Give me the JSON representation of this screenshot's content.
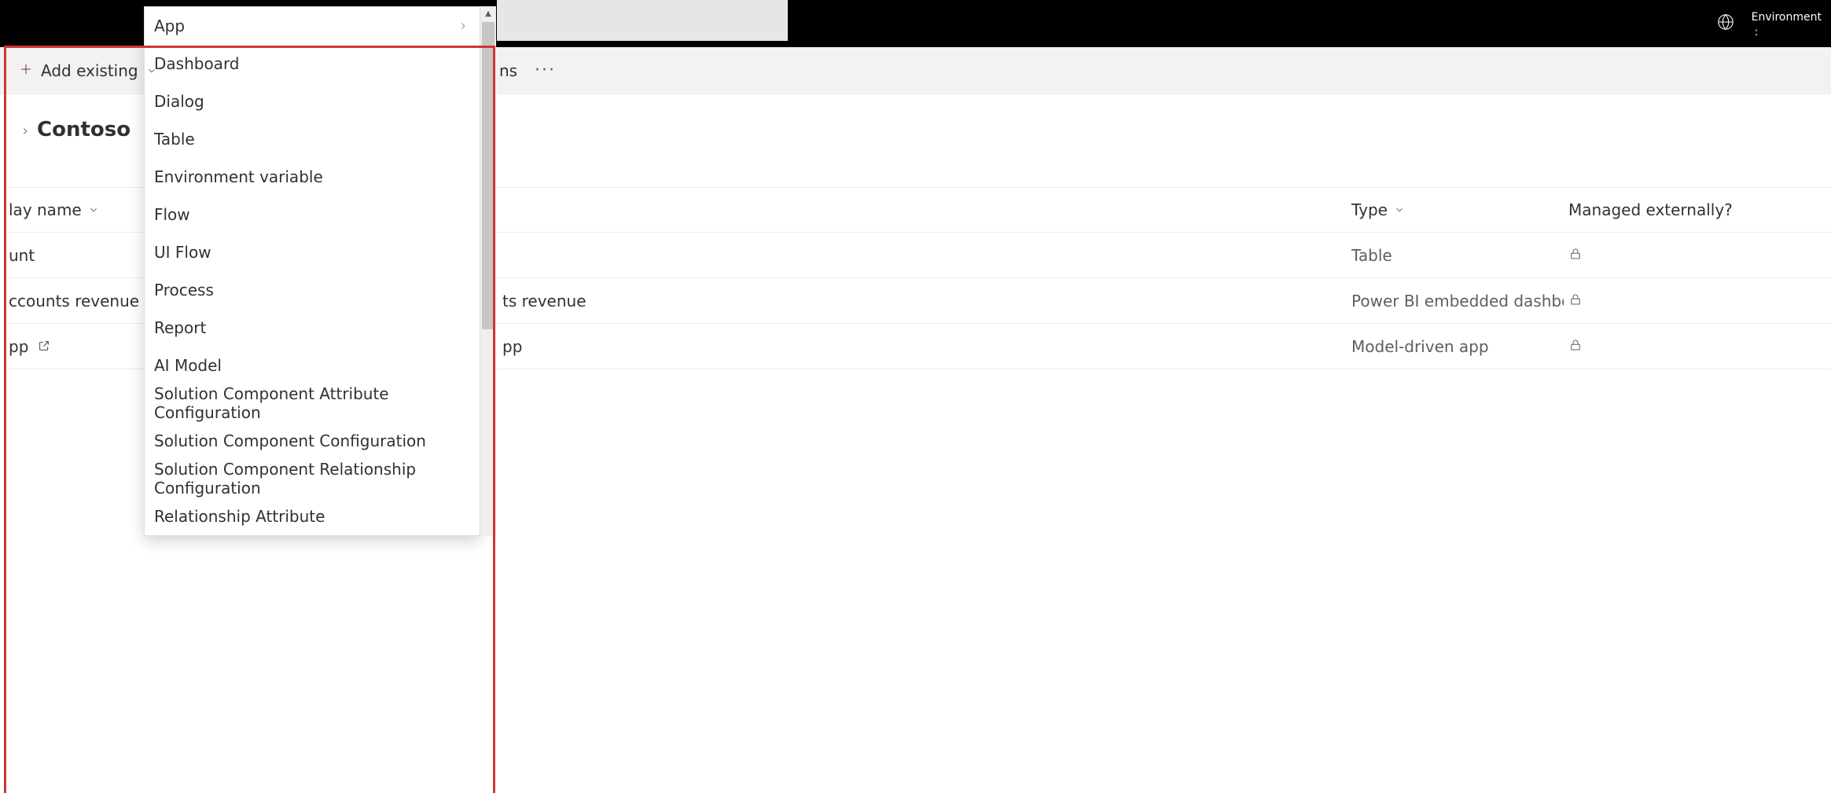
{
  "topbar": {
    "env_label": "Environment",
    "colon": ":"
  },
  "cmdbar": {
    "add_existing": "Add existing",
    "trail": "ns",
    "overflow": "···"
  },
  "page": {
    "title": "Contoso"
  },
  "grid": {
    "columns": {
      "display_name": "lay name",
      "type": "Type",
      "managed": "Managed externally?"
    },
    "rows": [
      {
        "name": "unt",
        "name_right": "",
        "type": "Table",
        "open": false,
        "locked": true
      },
      {
        "name": "ccounts revenue",
        "name_right": "ts revenue",
        "type": "Power BI embedded dashboard",
        "open": false,
        "locked": true
      },
      {
        "name": "pp",
        "name_right": "pp",
        "type": "Model-driven app",
        "open": true,
        "locked": true
      }
    ]
  },
  "menu": {
    "items": [
      {
        "label": "App",
        "has_sub": true
      },
      {
        "label": "Dashboard",
        "has_sub": false
      },
      {
        "label": "Dialog",
        "has_sub": false
      },
      {
        "label": "Table",
        "has_sub": false
      },
      {
        "label": "Environment variable",
        "has_sub": false
      },
      {
        "label": "Flow",
        "has_sub": false
      },
      {
        "label": "UI Flow",
        "has_sub": false
      },
      {
        "label": "Process",
        "has_sub": false
      },
      {
        "label": "Report",
        "has_sub": false
      },
      {
        "label": "AI Model",
        "has_sub": false
      },
      {
        "label": "Solution Component Attribute Configuration",
        "has_sub": false
      },
      {
        "label": "Solution Component Configuration",
        "has_sub": false
      },
      {
        "label": "Solution Component Relationship Configuration",
        "has_sub": false
      },
      {
        "label": "Relationship Attribute",
        "has_sub": false
      }
    ]
  }
}
